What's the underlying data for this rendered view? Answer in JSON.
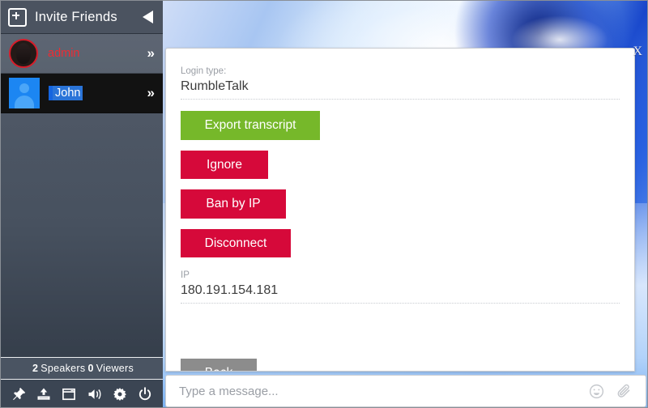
{
  "sidebar": {
    "header": {
      "title": "Invite Friends",
      "add_icon": "plus-square-icon",
      "collapse_icon": "triangle-left-icon"
    },
    "users": [
      {
        "name": "admin",
        "avatar": "photo-avatar",
        "chevron": "»",
        "selected": false
      },
      {
        "name": "John",
        "avatar": "default-person-avatar",
        "chevron": "»",
        "selected": true
      }
    ],
    "footer": {
      "speakers_count": "2",
      "speakers_label": "Speakers",
      "viewers_count": "0",
      "viewers_label": "Viewers"
    },
    "toolbar": [
      {
        "icon": "pin-icon"
      },
      {
        "icon": "upload-icon"
      },
      {
        "icon": "window-icon"
      },
      {
        "icon": "speaker-volume-icon"
      },
      {
        "icon": "gear-icon"
      },
      {
        "icon": "power-icon"
      }
    ]
  },
  "panel": {
    "close_label": "X",
    "login_type": {
      "label": "Login type:",
      "value": "RumbleTalk"
    },
    "actions": [
      {
        "label": "Export transcript",
        "color": "#76b82a"
      },
      {
        "label": "Ignore",
        "color": "#d6093a"
      },
      {
        "label": "Ban by IP",
        "color": "#d6093a"
      },
      {
        "label": "Disconnect",
        "color": "#d6093a"
      }
    ],
    "ip": {
      "label": "IP",
      "value": "180.191.154.181"
    },
    "back_label": "Back"
  },
  "message_bar": {
    "placeholder": "Type a message...",
    "value": "",
    "emoji_icon": "smiley-icon",
    "attach_icon": "paperclip-icon"
  },
  "colors": {
    "accent_green": "#76b82a",
    "accent_red": "#d6093a",
    "accent_gray": "#8c8c8c",
    "sidebar_bg": "#4f5866",
    "selected_row": "#121212",
    "admin_name": "#ee2b33"
  }
}
